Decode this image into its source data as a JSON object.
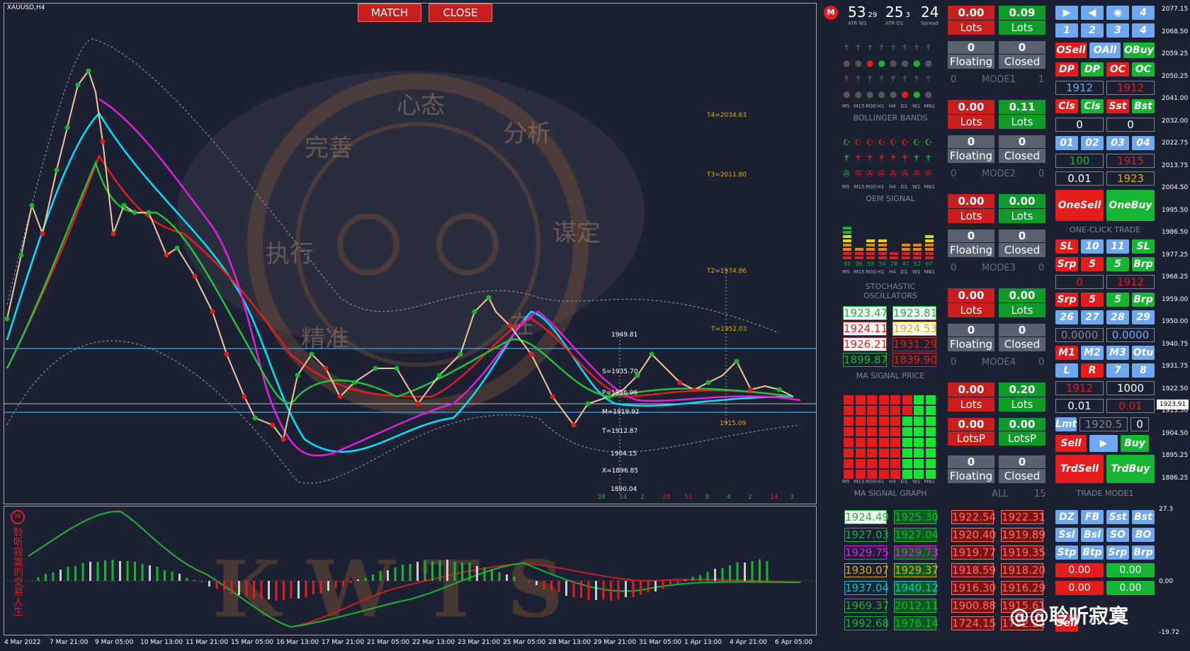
{
  "symbol": "XAUUSD,H4",
  "top_buttons": {
    "match": "MATCH",
    "close": "CLOSE"
  },
  "watermark": {
    "chars": [
      "心态",
      "完善",
      "分析",
      "执行",
      "谋定",
      "精准",
      "在"
    ],
    "kwts": [
      "K",
      "W",
      "T",
      "S"
    ]
  },
  "stats": [
    {
      "big": "53",
      "small": "29",
      "label": "ATR W1"
    },
    {
      "big": "25",
      "small": "3",
      "label": "ATR D1"
    },
    {
      "big": "24",
      "small": "",
      "label": "Spread"
    }
  ],
  "timeframes": [
    "M5",
    "M15",
    "M30",
    "H1",
    "H4",
    "D1",
    "W1",
    "MN1"
  ],
  "section_labels": {
    "bollinger": "BOLLINGER BANDS",
    "oem": "OEM   SIGNAL",
    "stoch": "STOCHASTIC OSCILLATORS",
    "ma_price": "MA SIGNAL PRICE",
    "ma_graph": "MA SIGNAL GRAPH",
    "one_click": "ONE-CLICK   TRADE",
    "trade_mode": "TRADE MODE1"
  },
  "stoch_values": [
    "91",
    "36",
    "58",
    "54",
    "28",
    "47",
    "52",
    "67"
  ],
  "ma_prices": [
    {
      "left": "1923.47",
      "right": "1923.81",
      "lc": "#16b532",
      "rc": "#16b532"
    },
    {
      "left": "1924.11",
      "right": "1924.53",
      "lc": "#e51c1c",
      "rc": "#e5a800"
    },
    {
      "left": "1926.21",
      "right": "1931.29",
      "lc": "#e51c1c",
      "rc": "#e51c1c"
    },
    {
      "left": "1899.87",
      "right": "1839.90",
      "lc": "#16b532",
      "rc": "#e51c1c"
    }
  ],
  "modes": [
    {
      "sell_val": "0.00",
      "buy_val": "0.09",
      "sell_lbl": "Lots",
      "buy_lbl": "Lots",
      "c1": "0",
      "c2": "0",
      "f": "Floating",
      "cl": "Closed",
      "m_left": "0",
      "m_name": "MODE1",
      "m_right": "1"
    },
    {
      "sell_val": "0.00",
      "buy_val": "0.11",
      "sell_lbl": "Lots",
      "buy_lbl": "Lots",
      "c1": "0",
      "c2": "0",
      "f": "Floating",
      "cl": "Closed",
      "m_left": "0",
      "m_name": "MODE2",
      "m_right": "0"
    },
    {
      "sell_val": "0.00",
      "buy_val": "0.00",
      "sell_lbl": "Lots",
      "buy_lbl": "Lots",
      "c1": "0",
      "c2": "0",
      "f": "Floating",
      "cl": "Closed",
      "m_left": "0",
      "m_name": "MODE3",
      "m_right": "0"
    },
    {
      "sell_val": "0.00",
      "buy_val": "0.00",
      "sell_lbl": "Lots",
      "buy_lbl": "Lots",
      "c1": "0",
      "c2": "0",
      "f": "Floating",
      "cl": "Closed",
      "m_left": "0",
      "m_name": "MODE4",
      "m_right": "0"
    },
    {
      "sell_val": "0.00",
      "buy_val": "0.20",
      "sell_lbl": "Lots",
      "buy_lbl": "Lots",
      "c1": "0.00",
      "c2": "0.00",
      "f": "LotsP",
      "cl": "LotsP",
      "m_left": "",
      "m_name": "",
      "m_right": ""
    }
  ],
  "all_row": {
    "sell_val": "0",
    "buy_val": "0",
    "f": "Floating",
    "cl": "Closed",
    "name": "ALL",
    "right": "15"
  },
  "right_panel": {
    "row1": [
      "▶",
      "◀",
      "◉",
      "4"
    ],
    "row2": [
      "1",
      "2",
      "3",
      "4"
    ],
    "row3": [
      "OSell",
      "OAll",
      "OBuy"
    ],
    "row4": [
      "DP",
      "DP",
      "OC",
      "OC"
    ],
    "row5": [
      "1912",
      "1912"
    ],
    "row6": [
      "Cls",
      "Cls",
      "Sst",
      "Bst"
    ],
    "row7": [
      "0",
      "0"
    ],
    "row8": [
      "01",
      "02",
      "03",
      "04"
    ],
    "row9": [
      "100",
      "1915"
    ],
    "row10": [
      "0.01",
      "1923"
    ],
    "oneclick": [
      "OneSell",
      "OneBuy"
    ],
    "row11": [
      "SL",
      "10",
      "11",
      "SL"
    ],
    "row12": [
      "Srp",
      "5",
      "5",
      "Brp"
    ],
    "row13": [
      "0",
      "1912"
    ],
    "row14": [
      "Srp",
      "5",
      "5",
      "Brp"
    ],
    "row15": [
      "26",
      "27",
      "28",
      "29"
    ],
    "row16": [
      "0.0000",
      "0.0000"
    ],
    "row17": [
      "M1",
      "M2",
      "M3",
      "Otu"
    ],
    "row18": [
      "L",
      "R",
      "7",
      "8"
    ],
    "row19": [
      "1912",
      "1000"
    ],
    "row20": [
      "0.01",
      "0.01"
    ],
    "row21": [
      "Lmt",
      "1920.5",
      "0"
    ],
    "row22": [
      "Sell",
      "▶",
      "Buy"
    ],
    "row23": [
      "TrdSell",
      "TrdBuy"
    ]
  },
  "bottom_prices_left": [
    [
      "1924.49",
      "1925.30"
    ],
    [
      "1927.03",
      "1927.04"
    ],
    [
      "1929.75",
      "1929.73"
    ],
    [
      "1930.07",
      "1929.37"
    ],
    [
      "1937.04",
      "1940.12"
    ],
    [
      "1969.37",
      "2012.11"
    ],
    [
      "1992.68",
      "1976.14"
    ]
  ],
  "bottom_prices_right": [
    [
      "1922.54",
      "1922.31"
    ],
    [
      "1920.40",
      "1919.89"
    ],
    [
      "1919.77",
      "1919.35"
    ],
    [
      "1918.59",
      "1918.20"
    ],
    [
      "1916.30",
      "1916.29"
    ],
    [
      "1900.88",
      "1915.61"
    ],
    [
      "1724.15",
      "1732.22"
    ]
  ],
  "bottom_btns": [
    [
      "DZ",
      "FB",
      "Sst",
      "Bst"
    ],
    [
      "Ssl",
      "Bsl",
      "SO",
      "BO"
    ],
    [
      "Stp",
      "Btp",
      "Srp",
      "Brp"
    ]
  ],
  "bottom_vals": [
    [
      "0.00",
      "0.00"
    ],
    [
      "0.00",
      "0.00"
    ]
  ],
  "bottom_btn_last": "Sell",
  "price_axis": [
    "2077.15",
    "2068.50",
    "2059.25",
    "2050.25",
    "2041.00",
    "2032.00",
    "2022.75",
    "2013.75",
    "2004.50",
    "1995.50",
    "1986.50",
    "1977.25",
    "1968.25",
    "1959.00",
    "1950.00",
    "1940.75",
    "1931.75",
    "1922.50",
    "1913.50",
    "1904.50",
    "1895.25",
    "1886.25"
  ],
  "current_price": "1923.91",
  "sub_axis": [
    "27.3",
    "0.00",
    "-19.72"
  ],
  "time_axis": [
    "4 Mar 2022",
    "7 Mar 21:00",
    "9 Mar 05:00",
    "10 Mar 13:00",
    "11 Mar 21:00",
    "15 Mar 05:00",
    "16 Mar 13:00",
    "17 Mar 21:00",
    "21 Mar 05:00",
    "22 Mar 13:00",
    "23 Mar 21:00",
    "25 Mar 05:00",
    "28 Mar 13:00",
    "29 Mar 21:00",
    "31 Mar 05:00",
    "1 Apr 13:00",
    "4 Apr 21:00",
    "6 Apr 05:00"
  ],
  "pivot_labels": [
    {
      "t": "T4=2034.63",
      "c": "#e5a800"
    },
    {
      "t": "T3=2011.80",
      "c": "#e5a800"
    },
    {
      "t": "T2=1974.86",
      "c": "#e5a800"
    },
    {
      "t": "T=1952.03",
      "c": "#e5a800"
    },
    {
      "t": "1949.81",
      "c": "#fff"
    },
    {
      "t": "S=1935.70",
      "c": "#fff"
    },
    {
      "t": "P=1926.96",
      "c": "#fff"
    },
    {
      "t": "M=1919.92",
      "c": "#fff"
    },
    {
      "t": "1915.09",
      "c": "#e5a800"
    },
    {
      "t": "T=1912.87",
      "c": "#fff"
    },
    {
      "t": "1904.15",
      "c": "#fff"
    },
    {
      "t": "X=1896.85",
      "c": "#fff"
    },
    {
      "t": "1890.04",
      "c": "#fff"
    }
  ],
  "bottom_counts": [
    {
      "t": "38",
      "c": "#16b532"
    },
    {
      "t": "14",
      "c": "#16b532"
    },
    {
      "t": "2",
      "c": "#16b532"
    },
    {
      "t": "29",
      "c": "#e51c1c"
    },
    {
      "t": "51",
      "c": "#e51c1c"
    },
    {
      "t": "8",
      "c": "#16b532"
    },
    {
      "t": "4",
      "c": "#16b532"
    },
    {
      "t": "2",
      "c": "#16b532"
    },
    {
      "t": "14",
      "c": "#e51c1c"
    },
    {
      "t": "3",
      "c": "#16b532"
    }
  ],
  "side_text": "聆听寂寞的交易人生",
  "watermark_credit": "@@聆听寂寞",
  "colors": {
    "bg": "#1b2033",
    "red": "#e51c1c",
    "green": "#16b532",
    "blue": "#6fa8f0",
    "grey": "#5a6170"
  }
}
